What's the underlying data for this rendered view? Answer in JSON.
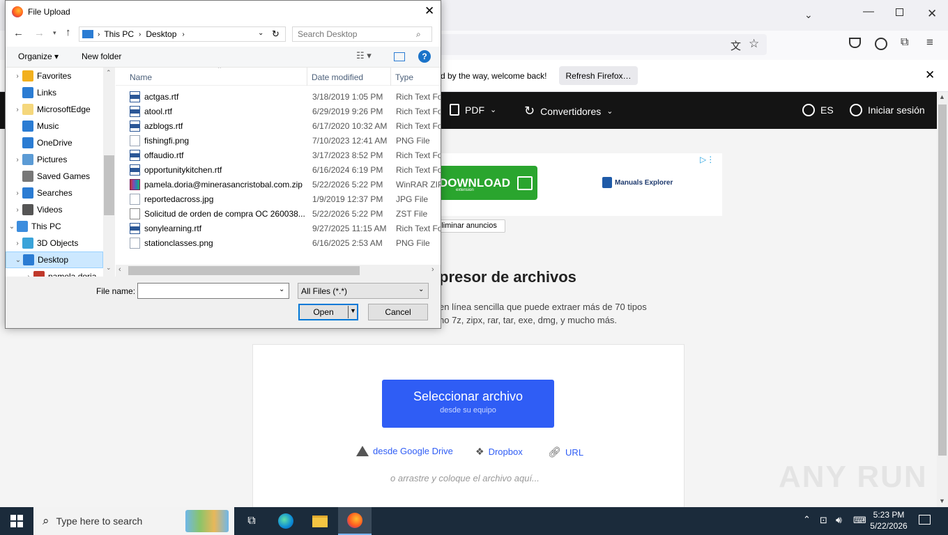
{
  "browser": {
    "notification_text": "d by the way, welcome back!",
    "refresh_button": "Refresh Firefox…"
  },
  "site": {
    "nav": {
      "pdf": "PDF",
      "converters": "Convertidores",
      "language": "ES",
      "login": "Iniciar sesión"
    },
    "ad": {
      "download_label": "DOWNLOAD",
      "download_sub": "extension",
      "manuals": "Manuals Explorer",
      "remove_ads": "Eliminar anuncios"
    },
    "heading": "presor de archivos",
    "description_line1": "en línea sencilla que puede extraer más de 70 tipos",
    "description_line2": "no 7z, zipx, rar, tar, exe, dmg, y mucho más.",
    "select_button": "Seleccionar archivo",
    "select_sub": "desde su equipo",
    "google_drive": "desde Google Drive",
    "dropbox": "Dropbox",
    "url": "URL",
    "drop_hint": "o arrastre y coloque el archivo aquí...",
    "watermark": "ANY RUN"
  },
  "dialog": {
    "title": "File Upload",
    "breadcrumb": [
      "This PC",
      "Desktop"
    ],
    "search_placeholder": "Search Desktop",
    "organize": "Organize",
    "new_folder": "New folder",
    "nav_items": [
      {
        "label": "Favorites",
        "icon": "star-icon",
        "color": "#f2b01e"
      },
      {
        "label": "Links",
        "icon": "links-icon",
        "color": "#2b7cd3"
      },
      {
        "label": "MicrosoftEdge",
        "icon": "folder-icon",
        "color": "#f5d77c"
      },
      {
        "label": "Music",
        "icon": "music-icon",
        "color": "#2b7cd3"
      },
      {
        "label": "OneDrive",
        "icon": "cloud-icon",
        "color": "#2b7cd3"
      },
      {
        "label": "Pictures",
        "icon": "pictures-icon",
        "color": "#5b9bd5"
      },
      {
        "label": "Saved Games",
        "icon": "games-icon",
        "color": "#777777"
      },
      {
        "label": "Searches",
        "icon": "search-icon",
        "color": "#2b7cd3"
      },
      {
        "label": "Videos",
        "icon": "videos-icon",
        "color": "#555555"
      },
      {
        "label": "This PC",
        "icon": "computer-icon",
        "color": "#3c8dde"
      },
      {
        "label": "3D Objects",
        "icon": "cube-icon",
        "color": "#3aa3d9"
      },
      {
        "label": "Desktop",
        "icon": "desktop-icon",
        "color": "#2b7cd3"
      },
      {
        "label": "pamela.doria",
        "icon": "folder-icon",
        "color": "#c0392b"
      }
    ],
    "columns": {
      "name": "Name",
      "date": "Date modified",
      "type": "Type"
    },
    "files": [
      {
        "name": "actgas.rtf",
        "date": "3/18/2019 1:05 PM",
        "type": "Rich Text For",
        "icon": "rtf-icon"
      },
      {
        "name": "atool.rtf",
        "date": "6/29/2019 9:26 PM",
        "type": "Rich Text For",
        "icon": "rtf-icon"
      },
      {
        "name": "azblogs.rtf",
        "date": "6/17/2020 10:32 AM",
        "type": "Rich Text For",
        "icon": "rtf-icon"
      },
      {
        "name": "fishingfi.png",
        "date": "7/10/2023 12:41 AM",
        "type": "PNG File",
        "icon": "image-icon"
      },
      {
        "name": "offaudio.rtf",
        "date": "3/17/2023 8:52 PM",
        "type": "Rich Text For",
        "icon": "rtf-icon"
      },
      {
        "name": "opportunitykitchen.rtf",
        "date": "6/16/2024 6:19 PM",
        "type": "Rich Text For",
        "icon": "rtf-icon"
      },
      {
        "name": "pamela.doria@minerasancristobal.com.zip",
        "date": "5/22/2026 5:22 PM",
        "type": "WinRAR ZIP",
        "icon": "winrar-icon"
      },
      {
        "name": "reportedacross.jpg",
        "date": "1/9/2019 12:37 PM",
        "type": "JPG File",
        "icon": "image-icon"
      },
      {
        "name": "Solicitud de orden de compra OC 260038...",
        "date": "5/22/2026 5:22 PM",
        "type": "ZST File",
        "icon": "blank-file-icon"
      },
      {
        "name": "sonylearning.rtf",
        "date": "9/27/2025 11:15 AM",
        "type": "Rich Text For",
        "icon": "rtf-icon"
      },
      {
        "name": "stationclasses.png",
        "date": "6/16/2025 2:53 AM",
        "type": "PNG File",
        "icon": "image-icon"
      }
    ],
    "file_name_label": "File name:",
    "file_name_value": "",
    "file_type": "All Files (*.*)",
    "open_button": "Open",
    "cancel_button": "Cancel"
  },
  "taskbar": {
    "search_placeholder": "Type here to search",
    "time": "5:23 PM",
    "date": "5/22/2026"
  }
}
